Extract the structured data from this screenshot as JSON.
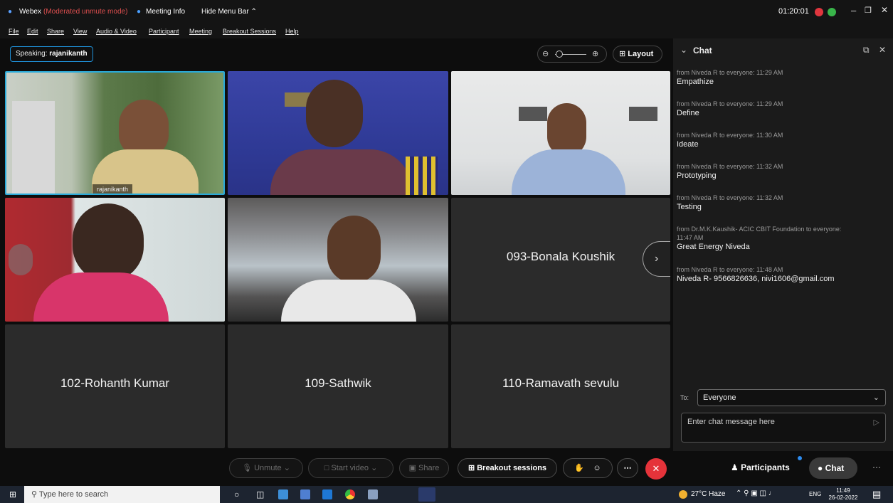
{
  "titlebar": {
    "app_name": "Webex",
    "mode": "(Moderated unmute mode)",
    "meeting_info": "Meeting Info",
    "hide_menu": "Hide Menu Bar",
    "timer": "01:20:01"
  },
  "menu": [
    "File",
    "Edit",
    "Share",
    "View",
    "Audio & Video",
    "Participant",
    "Meeting",
    "Breakout Sessions",
    "Help"
  ],
  "speaking": {
    "label": "Speaking:",
    "name": "rajanikanth"
  },
  "layout_label": "Layout",
  "tiles": {
    "t1_name": "rajanikanth",
    "t6_name": "093-Bonala Koushik",
    "t7_name": "102-Rohanth Kumar",
    "t8_name": "109-Sathwik",
    "t9_name": "110-Ramavath sevulu"
  },
  "chat": {
    "title": "Chat",
    "messages": [
      {
        "from": "from Niveda R to everyone:   11:29 AM",
        "body": "Empathize"
      },
      {
        "from": "from Niveda R to everyone:   11:29 AM",
        "body": "Define"
      },
      {
        "from": "from Niveda R to everyone:   11:30 AM",
        "body": "Ideate"
      },
      {
        "from": "from Niveda R to everyone:   11:32 AM",
        "body": "Prototyping"
      },
      {
        "from": "from Niveda R to everyone:   11:32 AM",
        "body": "Testing"
      },
      {
        "from": "from Dr.M.K.Kaushik- ACIC CBIT Foundation to everyone:",
        "from2": "11:47 AM",
        "body": "Great Energy Niveda"
      },
      {
        "from": "from Niveda R to everyone:   11:48 AM",
        "body": "Niveda R- 9566826636, nivi1606@gmail.com"
      }
    ],
    "to_label": "To:",
    "to_value": "Everyone",
    "input_placeholder": "Enter chat message here"
  },
  "controls": {
    "unmute": "Unmute",
    "start_video": "Start video",
    "share": "Share",
    "breakout": "Breakout sessions",
    "participants": "Participants",
    "chat": "Chat"
  },
  "taskbar": {
    "search_placeholder": "Type here to search",
    "weather": "27°C  Haze",
    "lang": "ENG",
    "time": "11:49",
    "date": "26-02-2022"
  }
}
